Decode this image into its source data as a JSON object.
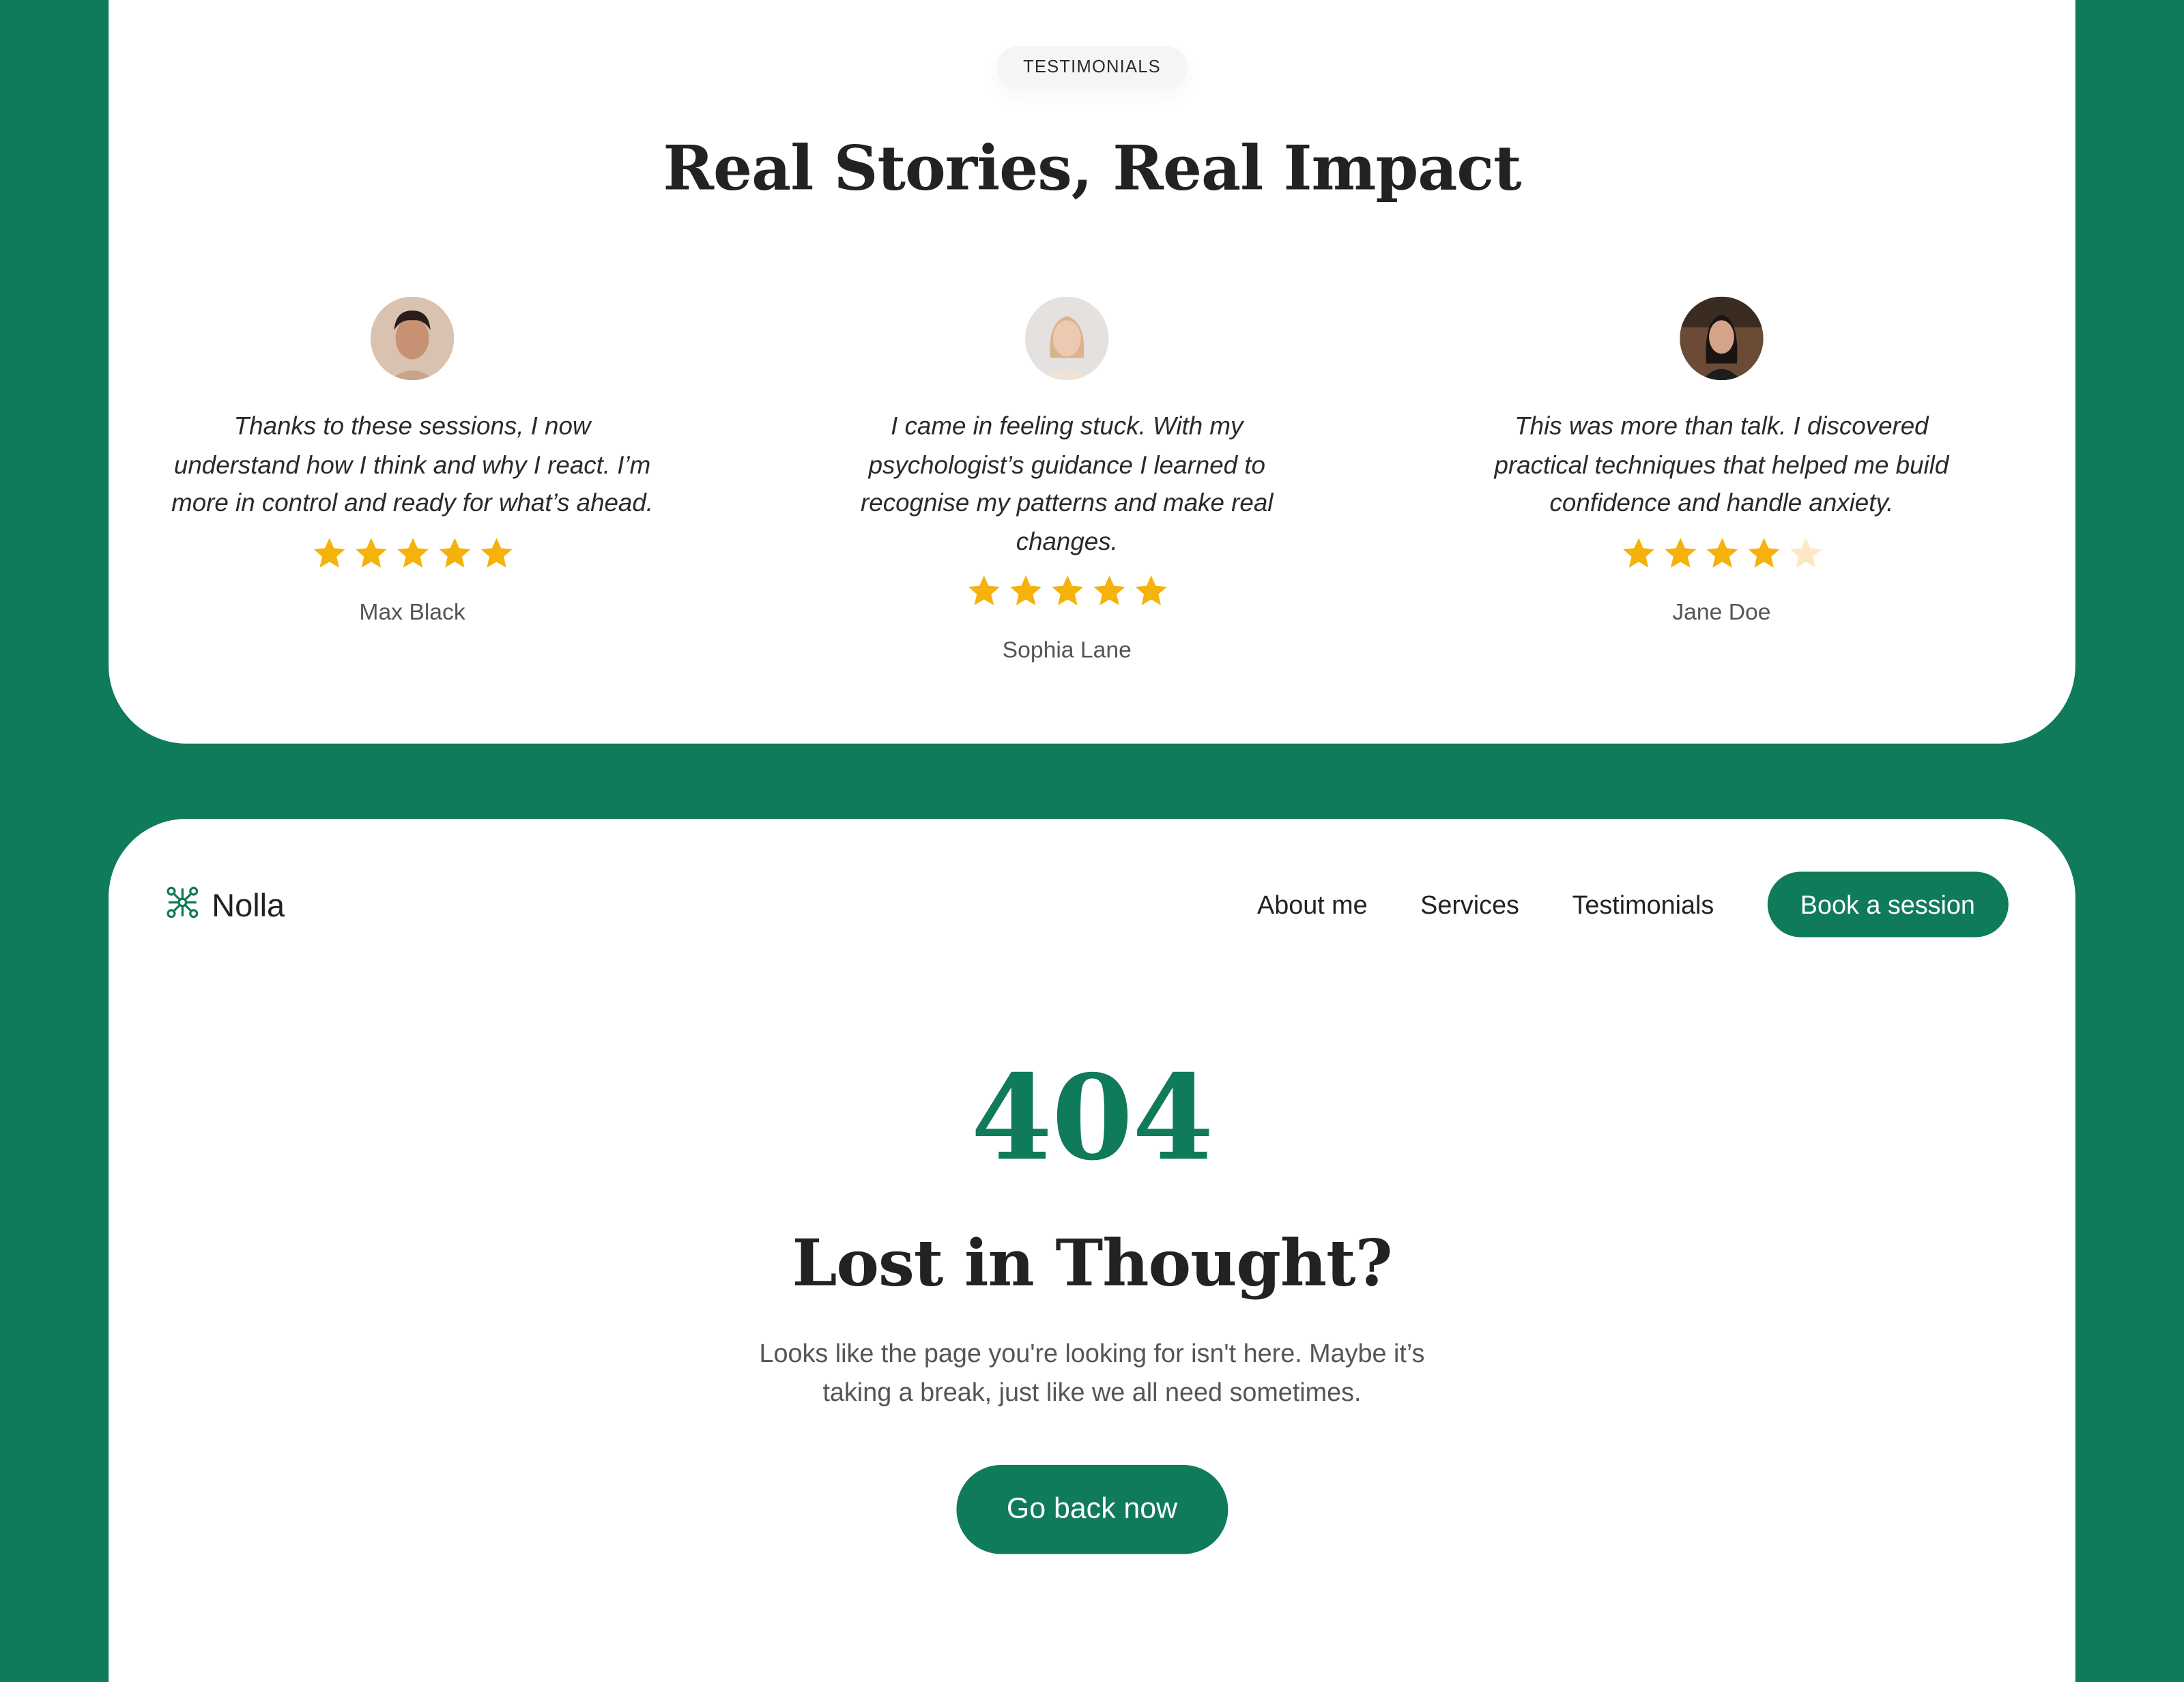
{
  "colors": {
    "brand": "#107b5b",
    "star": "#f5b20a",
    "star_empty": "#fde8c6",
    "text": "#222222",
    "muted": "#555555"
  },
  "testimonials_section": {
    "badge": "TESTIMONIALS",
    "title": "Real Stories, Real Impact",
    "items": [
      {
        "quote": "Thanks to these sessions, I now understand how I think and why I react. I’m more in control and ready for what’s ahead.",
        "rating": 5,
        "max_rating": 5,
        "name": "Max Black"
      },
      {
        "quote": "I came in feeling stuck. With my psychologist’s guidance I learned to recognise my patterns and make real changes.",
        "rating": 5,
        "max_rating": 5,
        "name": "Sophia Lane"
      },
      {
        "quote": "This was more than talk. I discovered practical techniques that helped me build confidence and handle anxiety.",
        "rating": 4,
        "max_rating": 5,
        "name": "Jane Doe"
      }
    ]
  },
  "header": {
    "logo_text": "Nolla",
    "logo_icon": "molecule-icon",
    "nav": [
      "About me",
      "Services",
      "Testimonials"
    ],
    "cta": "Book a session"
  },
  "not_found": {
    "code": "404",
    "title": "Lost in Thought?",
    "description": "Looks like the page you're looking for isn't here. Maybe it’s taking a break, just like we all need sometimes.",
    "button": "Go back now"
  }
}
